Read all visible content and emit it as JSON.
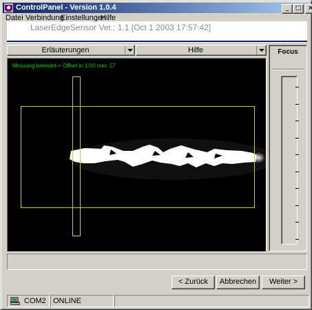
{
  "window": {
    "title": "ControlPanel - Version 1.0.4",
    "caption_buttons": {
      "minimize": "_",
      "maximize": "□",
      "close": "×"
    }
  },
  "menu": {
    "items": [
      {
        "label": "Datei"
      },
      {
        "label": "Verbindung"
      },
      {
        "label": "Einstellungen"
      },
      {
        "label": "Hilfe"
      }
    ]
  },
  "header": {
    "text": "LaserEdgeSensor Ver.: 1.1  [Oct  1 2003  17:57:42]"
  },
  "tabs": {
    "left": "Erläuterungen",
    "right": "Hilfe"
  },
  "viewer": {
    "status": "Messung beendet-> Offset in 1/10 mm: 17"
  },
  "focus": {
    "title": "Focus",
    "tick_count": 10
  },
  "buttons": {
    "back": "< Zurück",
    "cancel": "Abbrechen",
    "next": "Weiter >"
  },
  "statusbar": {
    "port": "COM2",
    "state": "ONLINE"
  },
  "colors": {
    "titlebar_start": "#0a246a",
    "titlebar_end": "#a6caf0",
    "overlay_text": "#00cc00",
    "roi": "#c8d800"
  }
}
